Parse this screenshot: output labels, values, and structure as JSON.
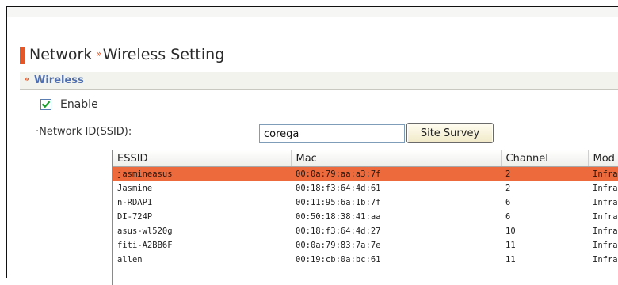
{
  "page": {
    "title_part1": "Network",
    "title_separator": "»",
    "title_part2": "Wireless Setting"
  },
  "section": {
    "chevron": "»",
    "label": "Wireless"
  },
  "enable": {
    "label": "Enable",
    "checked": true
  },
  "ssid": {
    "label": "·Network ID(SSID):",
    "value": "corega",
    "survey_button": "Site Survey"
  },
  "survey_table": {
    "columns": [
      "ESSID",
      "Mac",
      "Channel",
      "Mod"
    ],
    "rows": [
      {
        "essid": "jasmineasus",
        "mac": "00:0a:79:aa:a3:7f",
        "channel": "2",
        "mode": "Infra",
        "selected": true
      },
      {
        "essid": "Jasmine",
        "mac": "00:18:f3:64:4d:61",
        "channel": "2",
        "mode": "Infra"
      },
      {
        "essid": "n-RDAP1",
        "mac": "00:11:95:6a:1b:7f",
        "channel": "6",
        "mode": "Infra"
      },
      {
        "essid": "DI-724P",
        "mac": "00:50:18:38:41:aa",
        "channel": "6",
        "mode": "Infra"
      },
      {
        "essid": "asus-wl520g",
        "mac": "00:18:f3:64:4d:27",
        "channel": "10",
        "mode": "Infra"
      },
      {
        "essid": "fiti-A2BB6F",
        "mac": "00:0a:79:83:7a:7e",
        "channel": "11",
        "mode": "Infra"
      },
      {
        "essid": "allen",
        "mac": "00:19:cb:0a:bc:61",
        "channel": "11",
        "mode": "Infra"
      }
    ]
  },
  "colors": {
    "accent": "#e2582a",
    "selected_row": "#ec6a3c",
    "section_label": "#4f6fb0"
  }
}
